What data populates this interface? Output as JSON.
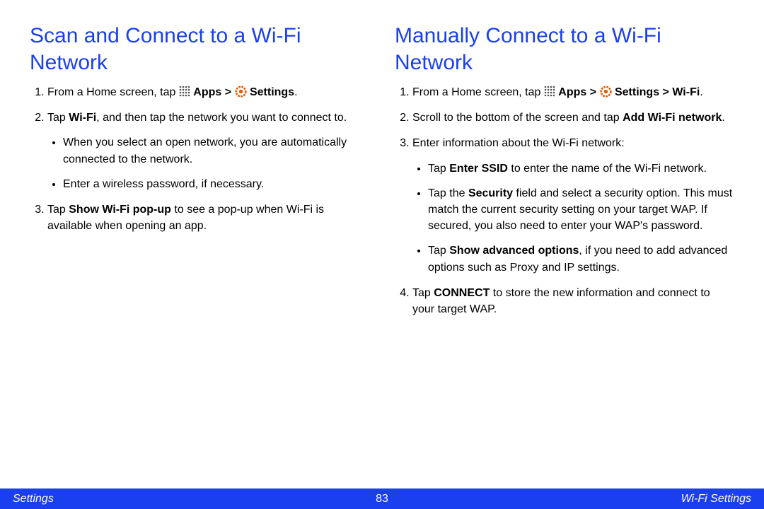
{
  "left": {
    "title": "Scan and Connect to a Wi-Fi Network",
    "step1_a": "From a Home screen, tap ",
    "apps": "Apps",
    "gt": " > ",
    "settings": "Settings",
    "period": ".",
    "step2_a": "Tap ",
    "step2_b": "Wi-Fi",
    "step2_c": ", and then tap the network you want to connect to.",
    "sub1": "When you select an open network, you are automatically connected to the network.",
    "sub2": "Enter a wireless password, if necessary.",
    "step3_a": "Tap ",
    "step3_b": "Show Wi-Fi pop-up",
    "step3_c": " to see a pop-up when Wi-Fi is available when opening an app."
  },
  "right": {
    "title": "Manually Connect to a Wi-Fi Network",
    "step1_a": "From a Home screen, tap ",
    "apps": "Apps",
    "gt": " > ",
    "settings": "Settings",
    "gt2": " > ",
    "wifi": "Wi-Fi",
    "period": ".",
    "step2_a": "Scroll to the bottom of the screen and tap ",
    "step2_b": "Add Wi-Fi network",
    "step2_c": ".",
    "step3": "Enter information about the Wi-Fi network:",
    "sub1_a": "Tap ",
    "sub1_b": "Enter SSID",
    "sub1_c": " to enter the name of the Wi-Fi network.",
    "sub2_a": "Tap the ",
    "sub2_b": "Security",
    "sub2_c": " field and select a security option. This must match the current security setting on your target WAP. If secured, you also need to enter your WAP's password.",
    "sub3_a": "Tap ",
    "sub3_b": "Show advanced options",
    "sub3_c": ", if you need to add advanced options such as Proxy and IP settings.",
    "step4_a": "Tap ",
    "step4_b": "CONNECT",
    "step4_c": " to store the new information and connect to your target WAP."
  },
  "footer": {
    "left": "Settings",
    "center": "83",
    "right": "Wi-Fi Settings"
  }
}
